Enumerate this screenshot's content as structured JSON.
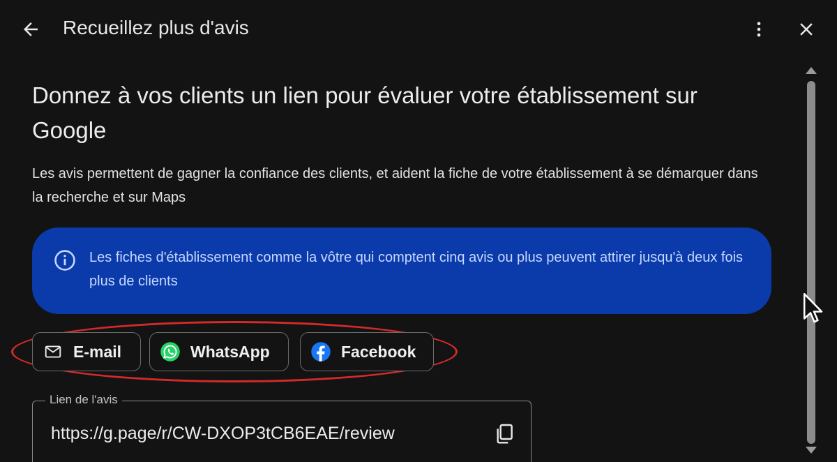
{
  "header": {
    "title": "Recueillez plus d'avis",
    "back_icon": "arrow-back-icon",
    "more_icon": "more-vertical-icon",
    "close_icon": "close-icon"
  },
  "content": {
    "heading": "Donnez à vos clients un lien pour évaluer votre établissement sur Google",
    "description": "Les avis permettent de gagner la confiance des clients, et aident la fiche de votre établissement à se démarquer dans la recherche et sur Maps"
  },
  "info_banner": {
    "icon": "info-icon",
    "text": "Les fiches d'établissement comme la vôtre qui comptent cinq avis ou plus peuvent attirer jusqu'à deux fois plus de clients",
    "background": "#0b3bab",
    "text_color": "#c6d8ff"
  },
  "share_options": {
    "email_label": "E-mail",
    "whatsapp_label": "WhatsApp",
    "facebook_label": "Facebook",
    "highlight_color": "#d32a2a",
    "whatsapp_color": "#25d366",
    "facebook_color": "#1877f2"
  },
  "review_link": {
    "label": "Lien de l'avis",
    "value": "https://g.page/r/CW-DXOP3tCB6EAE/review",
    "copy_icon": "copy-icon"
  },
  "scrollbar": {
    "thumb_fraction": 1.0
  }
}
